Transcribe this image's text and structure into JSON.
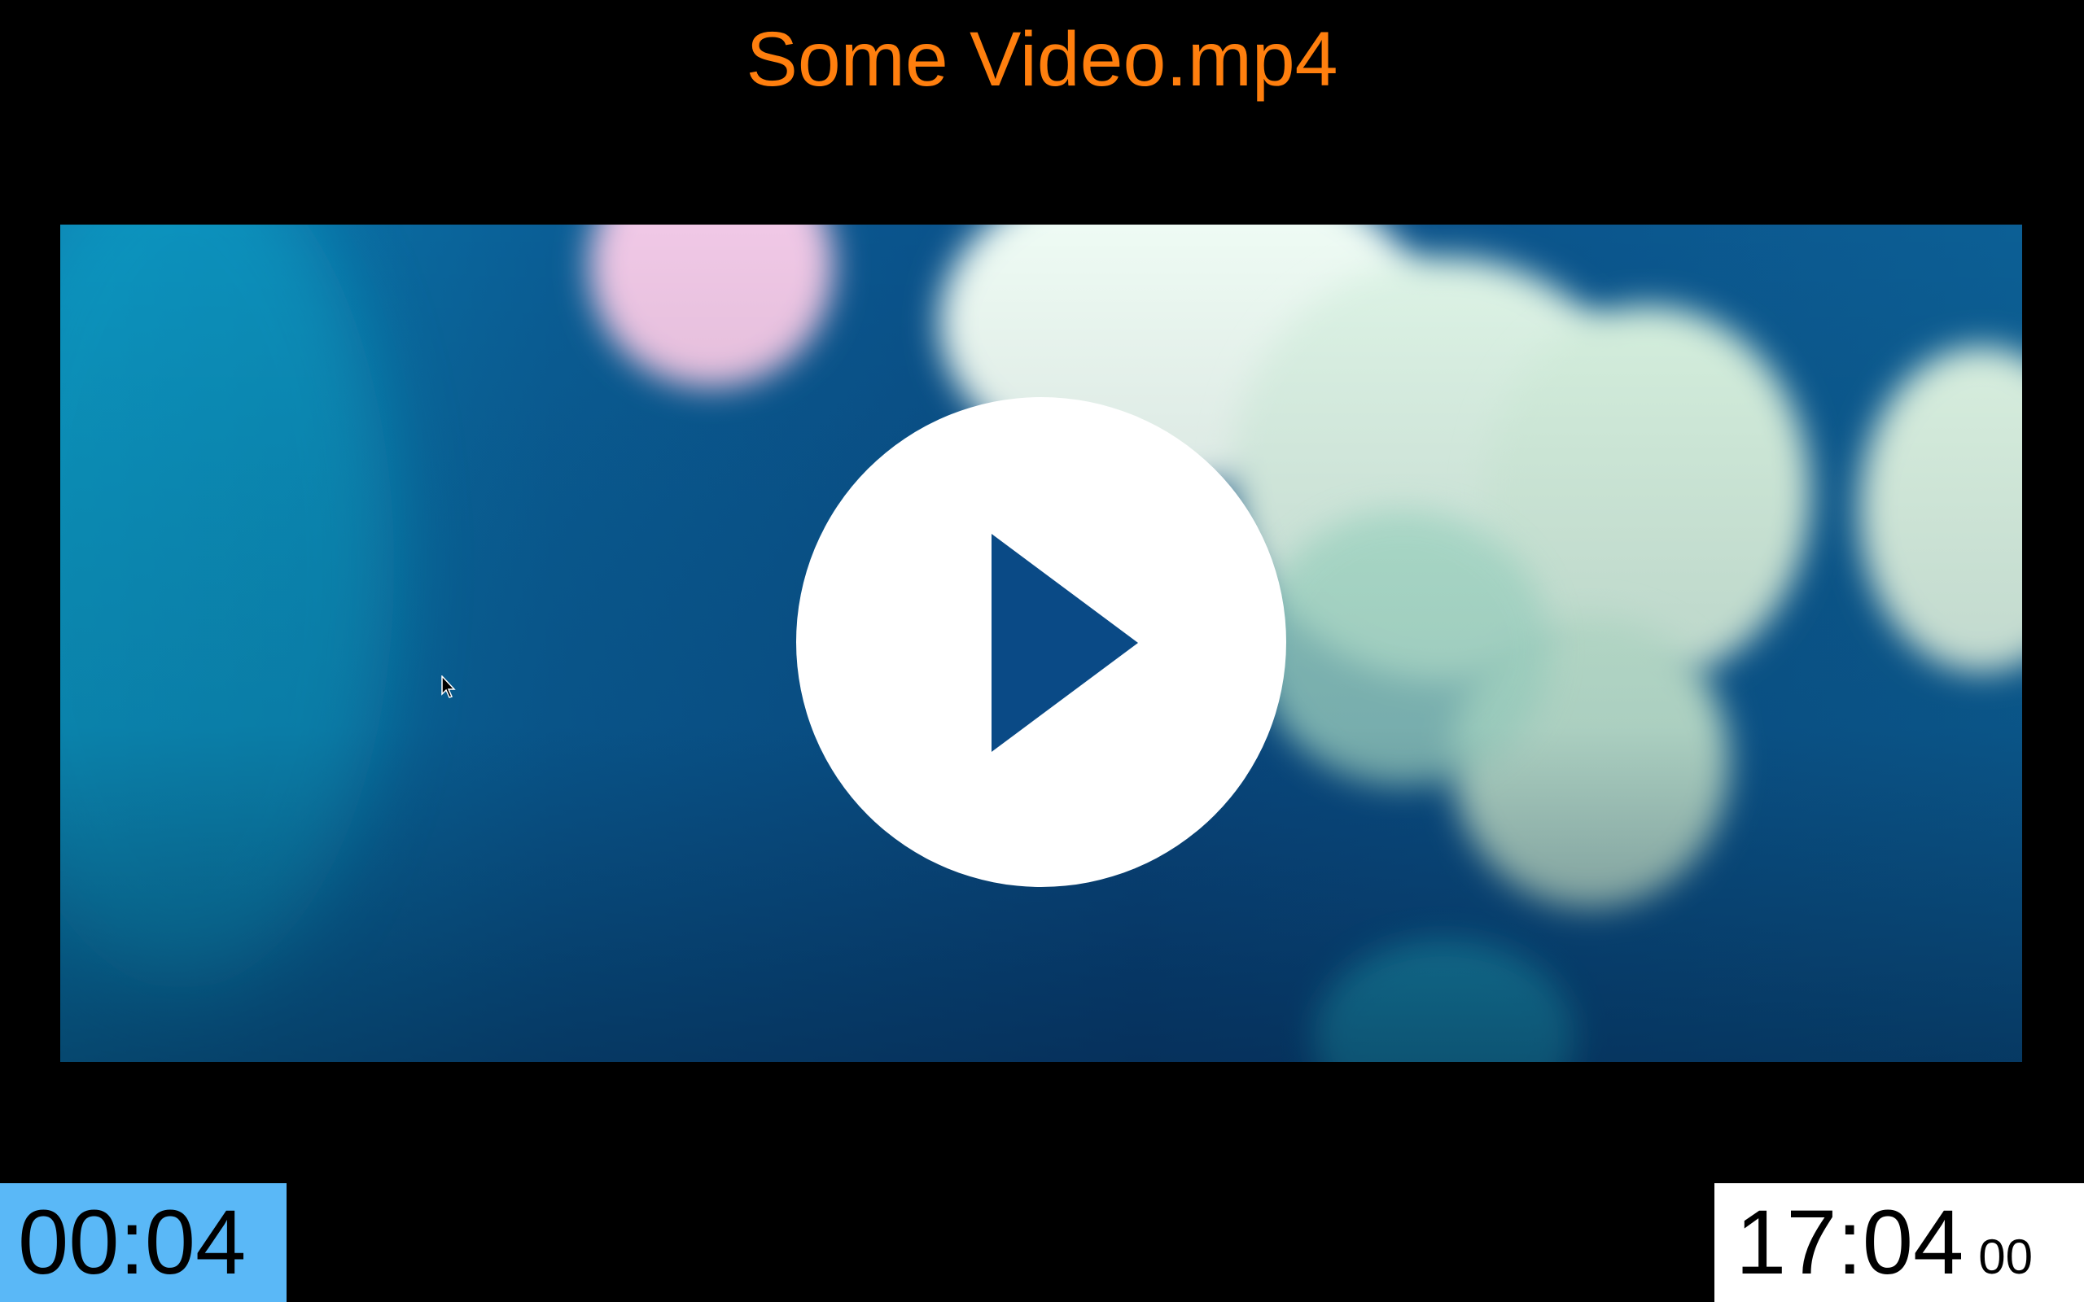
{
  "player": {
    "title": "Some Video.mp4",
    "elapsed_time": "00:04",
    "clock_hours_minutes": "17:04",
    "clock_seconds": "00"
  },
  "icons": {
    "play": "play-icon",
    "cursor": "mouse-pointer-icon"
  },
  "colors": {
    "title": "#ff7f0e",
    "elapsed_background": "#5ab8f7",
    "clock_background": "#ffffff",
    "play_triangle": "#0a4a86"
  }
}
